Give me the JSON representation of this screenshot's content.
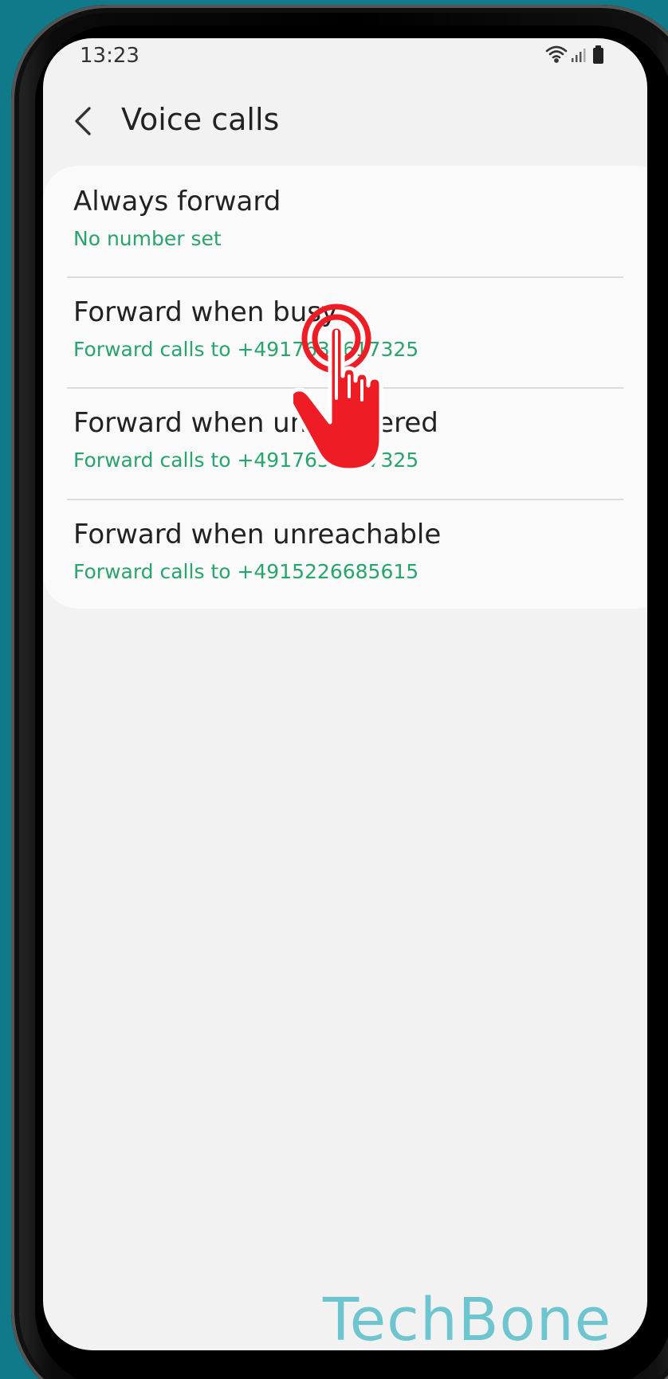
{
  "status_bar": {
    "time": "13:23",
    "icons": [
      "wifi-icon",
      "signal-icon",
      "battery-icon"
    ]
  },
  "header": {
    "back_icon": "chevron-left-icon",
    "title": "Voice calls"
  },
  "forward_options": [
    {
      "title": "Always forward",
      "subtitle": "No number set"
    },
    {
      "title": "Forward when busy",
      "subtitle": "Forward calls to +4917633617325"
    },
    {
      "title": "Forward when unanswered",
      "subtitle": "Forward calls to +4917633617325"
    },
    {
      "title": "Forward when unreachable",
      "subtitle": "Forward calls to +4915226685615"
    }
  ],
  "overlay": {
    "tap_icon": "tap-hand-icon"
  },
  "watermark": "TechBone",
  "colors": {
    "background": "#107a8a",
    "screen": "#f2f2f2",
    "card": "#fafafa",
    "accent_green": "#29a46c",
    "tap_red": "#ee1c24",
    "watermark": "#6fc5cf"
  }
}
